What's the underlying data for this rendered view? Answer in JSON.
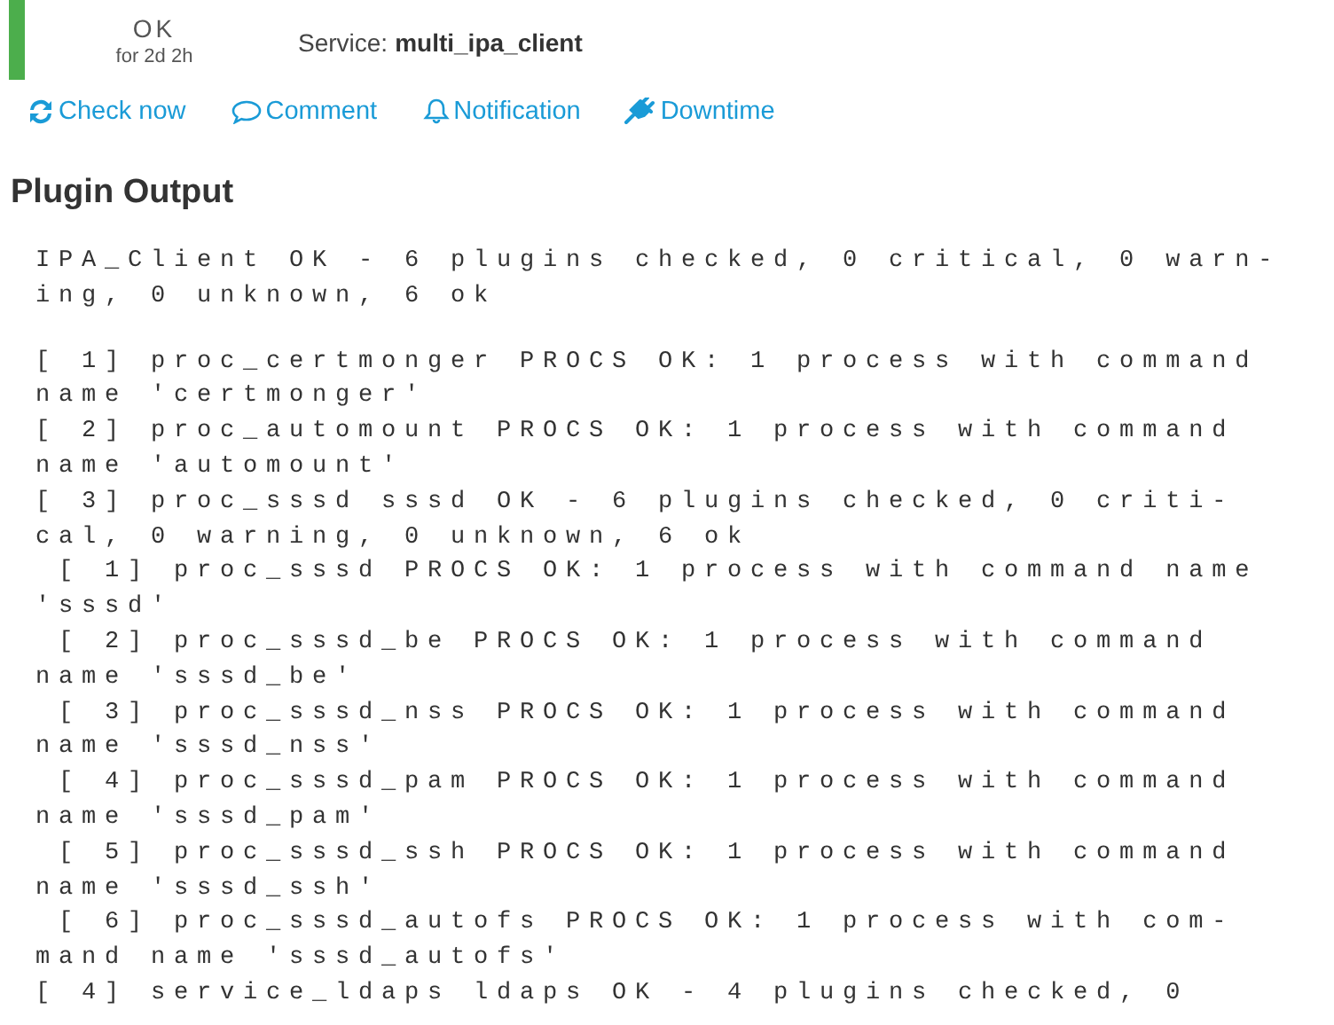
{
  "status": {
    "kind": "ok",
    "label": "OK",
    "duration": "for 2d 2h"
  },
  "service": {
    "label": "Service:",
    "name": "multi_ipa_client"
  },
  "actions": [
    {
      "kind": "refresh",
      "label": "Check now"
    },
    {
      "kind": "comment",
      "label": "Comment"
    },
    {
      "kind": "bell",
      "label": "Notification"
    },
    {
      "kind": "plug",
      "label": "Downtime"
    }
  ],
  "plugin_output": {
    "title": "Plugin Output",
    "paragraphs": [
      [
        "IPA_Client OK - 6 plugins checked, 0 critical, 0 warn-",
        "ing, 0 unknown, 6 ok"
      ],
      [
        "[ 1] proc_certmonger PROCS OK: 1 process with command",
        "name 'certmonger'",
        "[ 2] proc_automount PROCS OK: 1 process with command",
        "name 'automount'",
        "[ 3] proc_sssd sssd OK - 6 plugins checked, 0 criti-",
        "cal, 0 warning, 0 unknown, 6 ok",
        " [ 1] proc_sssd PROCS OK: 1 process with command name",
        "'sssd'",
        " [ 2] proc_sssd_be PROCS OK: 1 process with command",
        "name 'sssd_be'",
        " [ 3] proc_sssd_nss PROCS OK: 1 process with command",
        "name 'sssd_nss'",
        " [ 4] proc_sssd_pam PROCS OK: 1 process with command",
        "name 'sssd_pam'",
        " [ 5] proc_sssd_ssh PROCS OK: 1 process with command",
        "name 'sssd_ssh'",
        " [ 6] proc_sssd_autofs PROCS OK: 1 process with com-",
        "mand name 'sssd_autofs'",
        "[ 4] service_ldaps ldaps OK - 4 plugins checked, 0"
      ]
    ]
  }
}
